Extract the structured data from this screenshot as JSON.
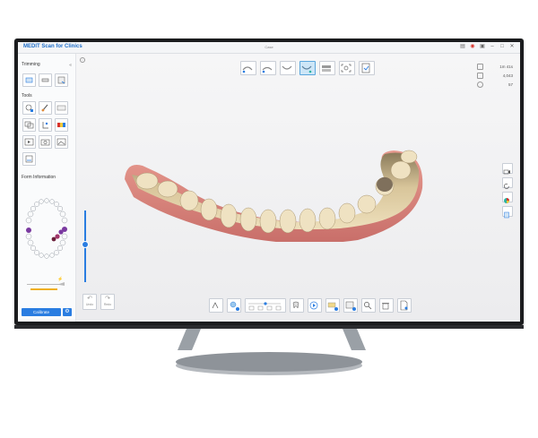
{
  "app": {
    "title": "MEDIT Scan for Clinics",
    "case_title": "Case"
  },
  "window_controls": [
    "notes-icon",
    "record-icon",
    "capture-icon",
    "minimize-icon",
    "maximize-icon",
    "close-icon"
  ],
  "sidebar": {
    "trimming_label": "Trimming",
    "tools_label": "Tools",
    "form_info_label": "Form Information",
    "calibrate_label": "Calibrate"
  },
  "stats": {
    "time": "1m 41s",
    "count": "4,043",
    "rate": "57"
  },
  "undo": {
    "label": "Undo"
  },
  "redo": {
    "label": "Redo"
  },
  "colors": {
    "accent": "#2a7de1",
    "app_title": "#1f6ec8",
    "gum": "#d07b74",
    "tooth": "#d8c59a"
  }
}
